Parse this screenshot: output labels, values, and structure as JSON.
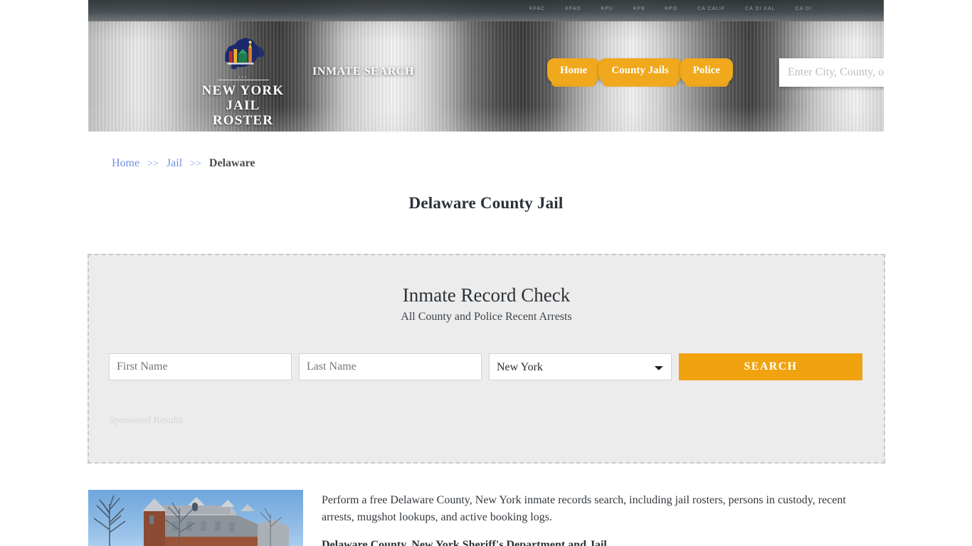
{
  "site": {
    "logo_line1": "NEW YORK",
    "logo_line2": "JAIL ROSTER",
    "logo_icon": "new-york-state-outline-icon",
    "tagline": "INMATE SEARCH"
  },
  "header": {
    "shelf_labels": [
      "KFAC",
      "KFAD",
      "KPU",
      "KP8",
      "KPO",
      "CA CALIF",
      "CA DI KAL",
      "CA DI"
    ],
    "nav": [
      {
        "label": "Home"
      },
      {
        "label": "County Jails"
      },
      {
        "label": "Police"
      }
    ],
    "search": {
      "placeholder": "Enter City, County, or Facil",
      "value": "",
      "button_icon": "search-icon"
    }
  },
  "breadcrumb": {
    "items": [
      {
        "label": "Home",
        "link": true
      },
      {
        "label": "Jail",
        "link": true
      },
      {
        "label": "Delaware",
        "link": false
      }
    ],
    "separator": ">>"
  },
  "page": {
    "title": "Delaware County Jail"
  },
  "search_panel": {
    "title": "Inmate Record Check",
    "subtitle": "All County and Police Recent Arrests",
    "first_name": {
      "placeholder": "First Name",
      "value": ""
    },
    "last_name": {
      "placeholder": "Last Name",
      "value": ""
    },
    "state": {
      "selected": "New York",
      "options": [
        "New York"
      ]
    },
    "submit_label": "SEARCH",
    "sponsored_label": "Sponsored Results"
  },
  "content": {
    "thumbnail_alt": "delaware-county-courthouse-photo",
    "paragraph": "Perform a free Delaware County, New York inmate records search, including jail rosters, persons in custody, recent arrests, mugshot lookups, and active booking logs.",
    "subheading": "Delaware County, New York Sheriff's Department and Jail"
  },
  "colors": {
    "accent_orange": "#f0a81c",
    "button_orange": "#f0a30f",
    "link_blue": "#6f8fe0",
    "panel_bg": "#ececec",
    "text_dark": "#2b3138"
  }
}
